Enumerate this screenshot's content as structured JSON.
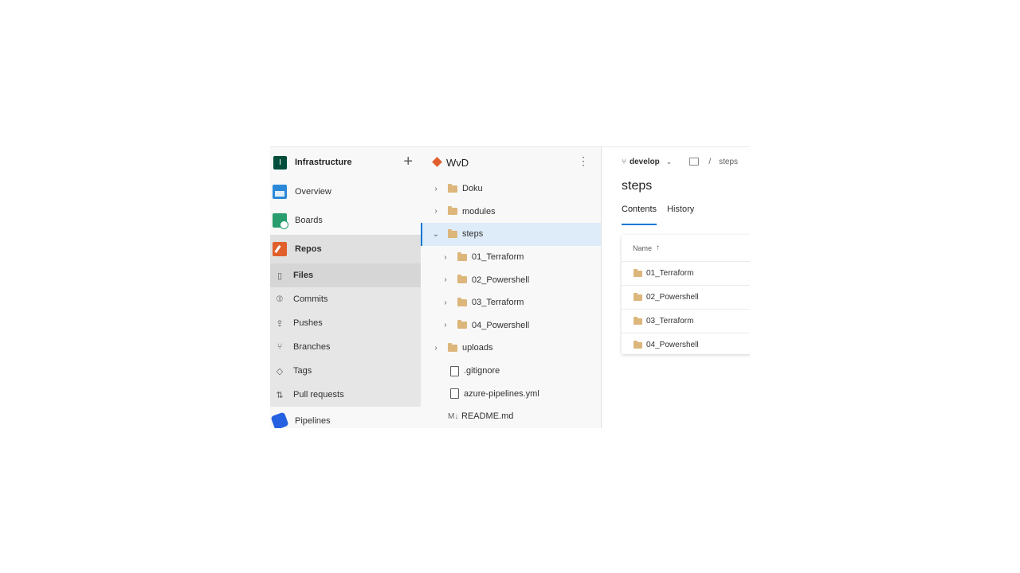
{
  "project": {
    "avatar": "I",
    "name": "Infrastructure"
  },
  "nav": {
    "overview": "Overview",
    "boards": "Boards",
    "repos": "Repos",
    "sub_items": [
      {
        "label": "Files",
        "icon": "file-code-icon",
        "active": true
      },
      {
        "label": "Commits",
        "icon": "commit-icon"
      },
      {
        "label": "Pushes",
        "icon": "push-icon"
      },
      {
        "label": "Branches",
        "icon": "branch-icon"
      },
      {
        "label": "Tags",
        "icon": "tag-icon"
      },
      {
        "label": "Pull requests",
        "icon": "pull-request-icon"
      }
    ],
    "pipelines": "Pipelines"
  },
  "repo": {
    "name": "WvD"
  },
  "tree": {
    "items": [
      {
        "name": "Doku",
        "type": "folder",
        "level": 0,
        "expanded": false
      },
      {
        "name": "modules",
        "type": "folder",
        "level": 0,
        "expanded": false
      },
      {
        "name": "steps",
        "type": "folder",
        "level": 0,
        "expanded": true,
        "selected": true
      },
      {
        "name": "01_Terraform",
        "type": "folder",
        "level": 1,
        "expanded": false
      },
      {
        "name": "02_Powershell",
        "type": "folder",
        "level": 1,
        "expanded": false
      },
      {
        "name": "03_Terraform",
        "type": "folder",
        "level": 1,
        "expanded": false
      },
      {
        "name": "04_Powershell",
        "type": "folder",
        "level": 1,
        "expanded": false
      },
      {
        "name": "uploads",
        "type": "folder",
        "level": 0,
        "expanded": false
      },
      {
        "name": ".gitignore",
        "type": "file",
        "level": 0
      },
      {
        "name": "azure-pipelines.yml",
        "type": "file",
        "level": 0
      },
      {
        "name": "README.md",
        "type": "markdown",
        "level": 0,
        "icon_text": "M↓"
      }
    ]
  },
  "content": {
    "branch": "develop",
    "crumb_separator": "/",
    "crumb_folder": "steps",
    "title": "steps",
    "tabs": [
      "Contents",
      "History"
    ],
    "table_header": "Name",
    "sort_arrow": "↑",
    "rows": [
      "01_Terraform",
      "02_Powershell",
      "03_Terraform",
      "04_Powershell"
    ]
  },
  "colors": {
    "accent": "#0078d4",
    "project_avatar": "#004e3b",
    "repos_icon": "#e05f2c",
    "folder": "#dcb67a"
  }
}
